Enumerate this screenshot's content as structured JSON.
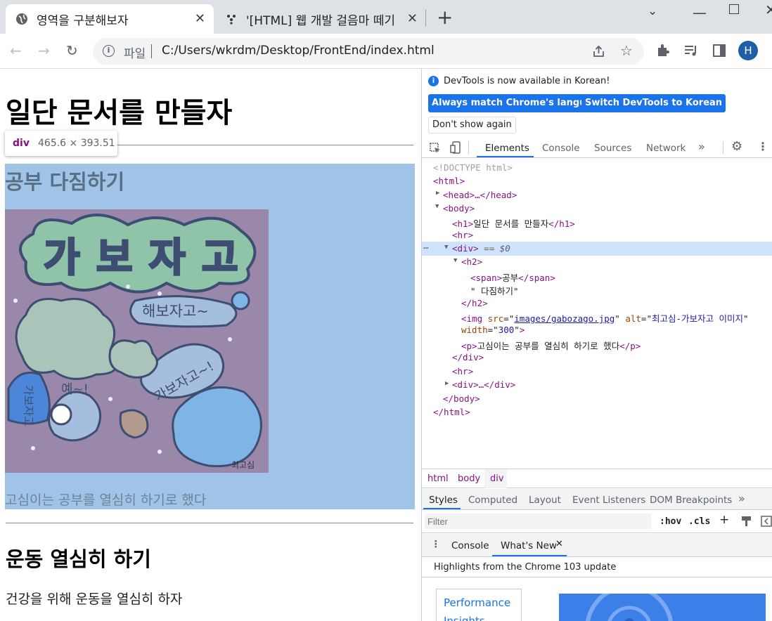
{
  "tabs": [
    {
      "title": "영역을 구분해보자"
    },
    {
      "title": "'[HTML] 웹 개발 걸음마 떼기"
    }
  ],
  "new_tab": "+",
  "window": {
    "minimize": "﹀",
    "restore": "□",
    "close": "✕"
  },
  "address": {
    "prefix": "파일",
    "url": "C:/Users/wkrdm/Desktop/FrontEnd/index.html"
  },
  "profile_initial": "H",
  "page": {
    "h1": "일단 문서를 만들자",
    "tooltip": {
      "tag": "div",
      "size": "465.6 × 393.51"
    },
    "section1": {
      "span": "공부",
      "rest": " 다짐하기",
      "p": "고심이는 공부를 열심히 하기로 했다"
    },
    "image": {
      "words": [
        "가",
        "보",
        "자",
        "고"
      ],
      "bubble1": "해보자고~",
      "bubble2": "가보자고~!",
      "bubble3": "예~!",
      "side": "가보자고",
      "sign": "최고심"
    },
    "section2": {
      "h2": "운동 열심히 하기",
      "p": "건강을 위해 운동을 열심히 하자"
    }
  },
  "devtools": {
    "banner": "DevTools is now available in Korean!",
    "btn_match": "Always match Chrome's language",
    "btn_switch": "Switch DevTools to Korean",
    "btn_dont": "Don't show again",
    "tabs": [
      "Elements",
      "Console",
      "Sources",
      "Network",
      "»"
    ],
    "tree": {
      "doctype": "<!DOCTYPE html>",
      "html_open": "<html>",
      "head": "<head>…</head>",
      "body_open": "<body>",
      "h1_text": "일단 문서를 만들자",
      "hr": "<hr>",
      "div_eq": "== $0",
      "h2_open": "<h2>",
      "span_text": "공부",
      "text_node": "\" 다짐하기\"",
      "h2_close": "</h2>",
      "img_src": "images/gabozago.jpg",
      "img_alt": "최고심-가보자고 이미지",
      "img_width": "300",
      "p_text": "고심이는 공부를 열심히 하기로 했다",
      "div_close": "</div>",
      "div_collapsed": "<div>…</div>",
      "body_close": "</body>",
      "html_close": "</html>"
    },
    "breadcrumb": [
      "html",
      "body",
      "div"
    ],
    "style_tabs": [
      "Styles",
      "Computed",
      "Layout",
      "Event Listeners",
      "DOM Breakpoints",
      "»"
    ],
    "filter_placeholder": "Filter",
    "hov": ":hov",
    "cls": ".cls",
    "drawer_tabs": [
      "Console",
      "What's New"
    ],
    "highlights": "Highlights from the Chrome 103 update",
    "card": "Performance Insights"
  },
  "colors": {
    "accent": "#1a73e8",
    "highlight": "#a0c4e8",
    "tag": "#881280"
  }
}
